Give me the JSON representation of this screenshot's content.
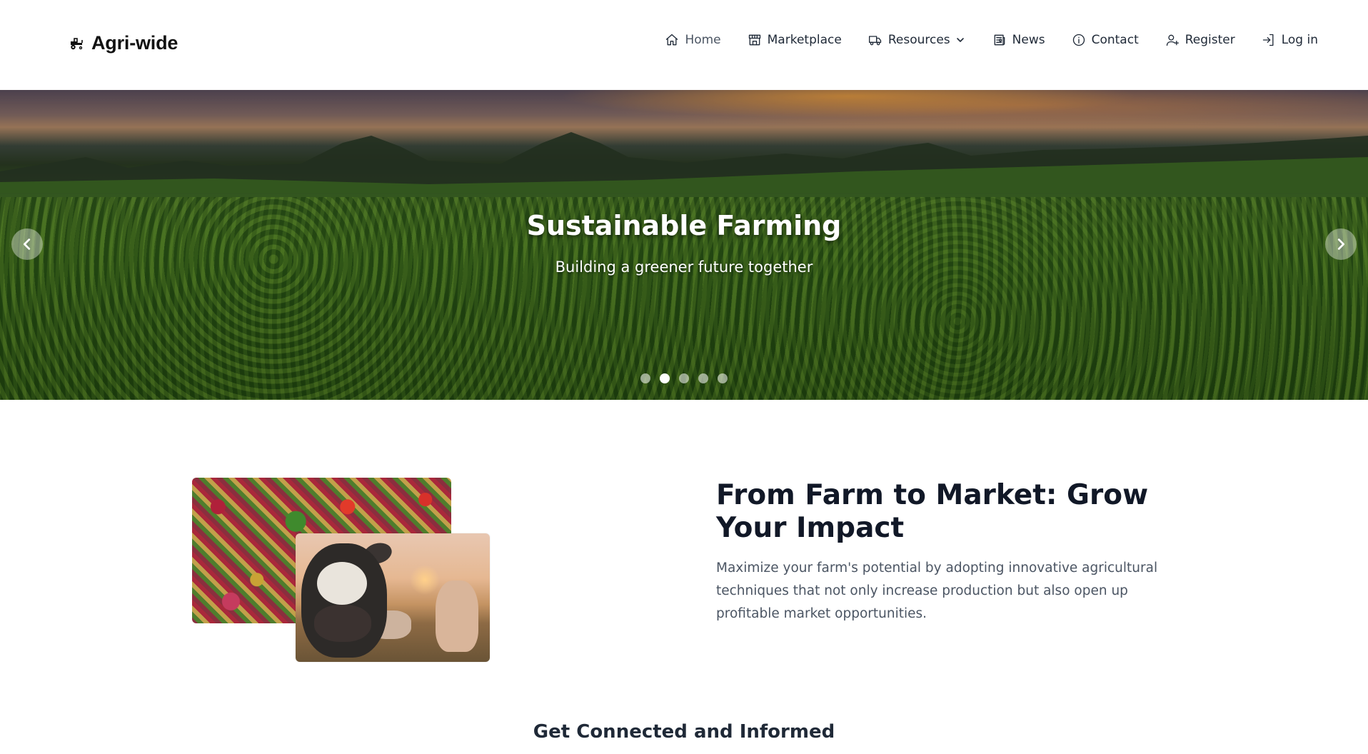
{
  "brand": {
    "name": "Agri-wide",
    "icon": "tractor-icon"
  },
  "nav": {
    "items": [
      {
        "label": "Home",
        "icon": "home-icon",
        "active": true
      },
      {
        "label": "Marketplace",
        "icon": "store-icon"
      },
      {
        "label": "Resources",
        "icon": "truck-icon",
        "has_dropdown": true
      },
      {
        "label": "News",
        "icon": "newspaper-icon"
      },
      {
        "label": "Contact",
        "icon": "info-icon"
      },
      {
        "label": "Register",
        "icon": "user-plus-icon"
      },
      {
        "label": "Log in",
        "icon": "login-icon"
      }
    ]
  },
  "hero": {
    "title": "Sustainable Farming",
    "subtitle": "Building a greener future together",
    "slides_count": 5,
    "active_slide": 2
  },
  "feature": {
    "title": "From Farm to Market: Grow Your Impact",
    "text": "Maximize your farm's potential by adopting innovative agricultural techniques that not only increase production but also open up profitable market opportunities."
  },
  "section": {
    "title": "Get Connected and Informed"
  },
  "colors": {
    "heading": "#111827",
    "body_text": "#4b5563",
    "background": "#ffffff"
  }
}
